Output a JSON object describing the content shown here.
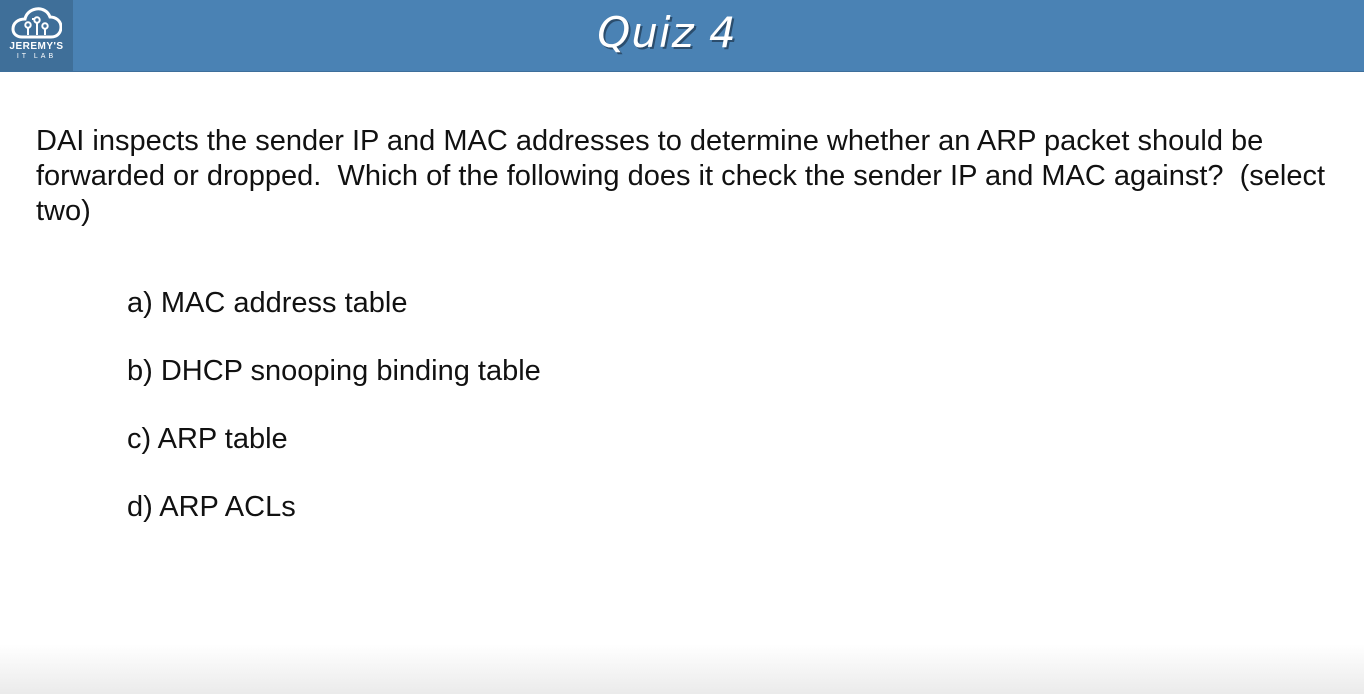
{
  "header": {
    "title": "Quiz 4",
    "logo": {
      "line1": "JEREMY'S",
      "line2": "IT LAB",
      "icon": "cloud-circuit-icon"
    }
  },
  "question": {
    "text": "DAI inspects the sender IP and MAC addresses to determine whether an ARP packet should be forwarded or dropped.  Which of the following does it check the sender IP and MAC against?  (select two)"
  },
  "options": [
    {
      "label": "a) MAC address table"
    },
    {
      "label": "b) DHCP snooping binding table"
    },
    {
      "label": "c) ARP table"
    },
    {
      "label": "d) ARP ACLs"
    }
  ],
  "colors": {
    "header_bg": "#4a82b4",
    "logo_bg": "#3f6f99",
    "text": "#111111"
  }
}
